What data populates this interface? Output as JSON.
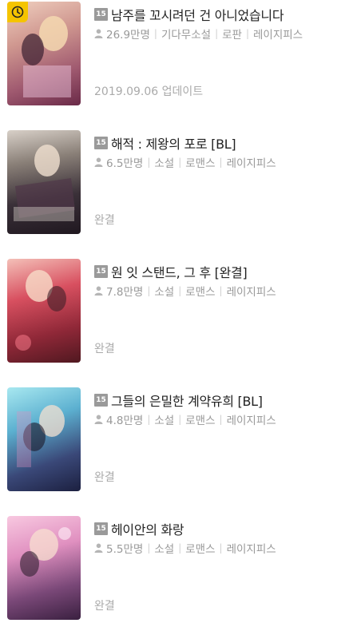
{
  "items": [
    {
      "title": "남주를 꼬시려던 건 아니었습니다",
      "age": "15",
      "views": "26.9만명",
      "tags": [
        "기다무소설",
        "로판",
        "레이지피스"
      ],
      "status": "2019.09.06 업데이트",
      "has_clock_badge": true,
      "cover_text": "",
      "cover_colors": [
        "#c8a090",
        "#8a4060"
      ]
    },
    {
      "title": "해적 : 제왕의 포로 [BL]",
      "age": "15",
      "views": "6.5만명",
      "tags": [
        "소설",
        "로맨스",
        "레이지피스"
      ],
      "status": "완결",
      "has_clock_badge": false,
      "cover_text": "",
      "cover_colors": [
        "#3a3440",
        "#a09890"
      ]
    },
    {
      "title": "원  잇 스탠드, 그 후 [완결]",
      "age": "15",
      "views": "7.8만명",
      "tags": [
        "소설",
        "로맨스",
        "레이지피스"
      ],
      "status": "완결",
      "has_clock_badge": false,
      "cover_text": "",
      "cover_colors": [
        "#d04050",
        "#602030"
      ]
    },
    {
      "title": "그들의 은밀한 계약유희 [BL]",
      "age": "15",
      "views": "4.8만명",
      "tags": [
        "소설",
        "로맨스",
        "레이지피스"
      ],
      "status": "완결",
      "has_clock_badge": false,
      "cover_text": "",
      "cover_colors": [
        "#60c0d8",
        "#203050"
      ]
    },
    {
      "title": "헤이안의 화랑",
      "age": "15",
      "views": "5.5만명",
      "tags": [
        "소설",
        "로맨스",
        "레이지피스"
      ],
      "status": "완결",
      "has_clock_badge": false,
      "cover_text": "",
      "cover_colors": [
        "#f0a0c0",
        "#503060"
      ]
    }
  ]
}
